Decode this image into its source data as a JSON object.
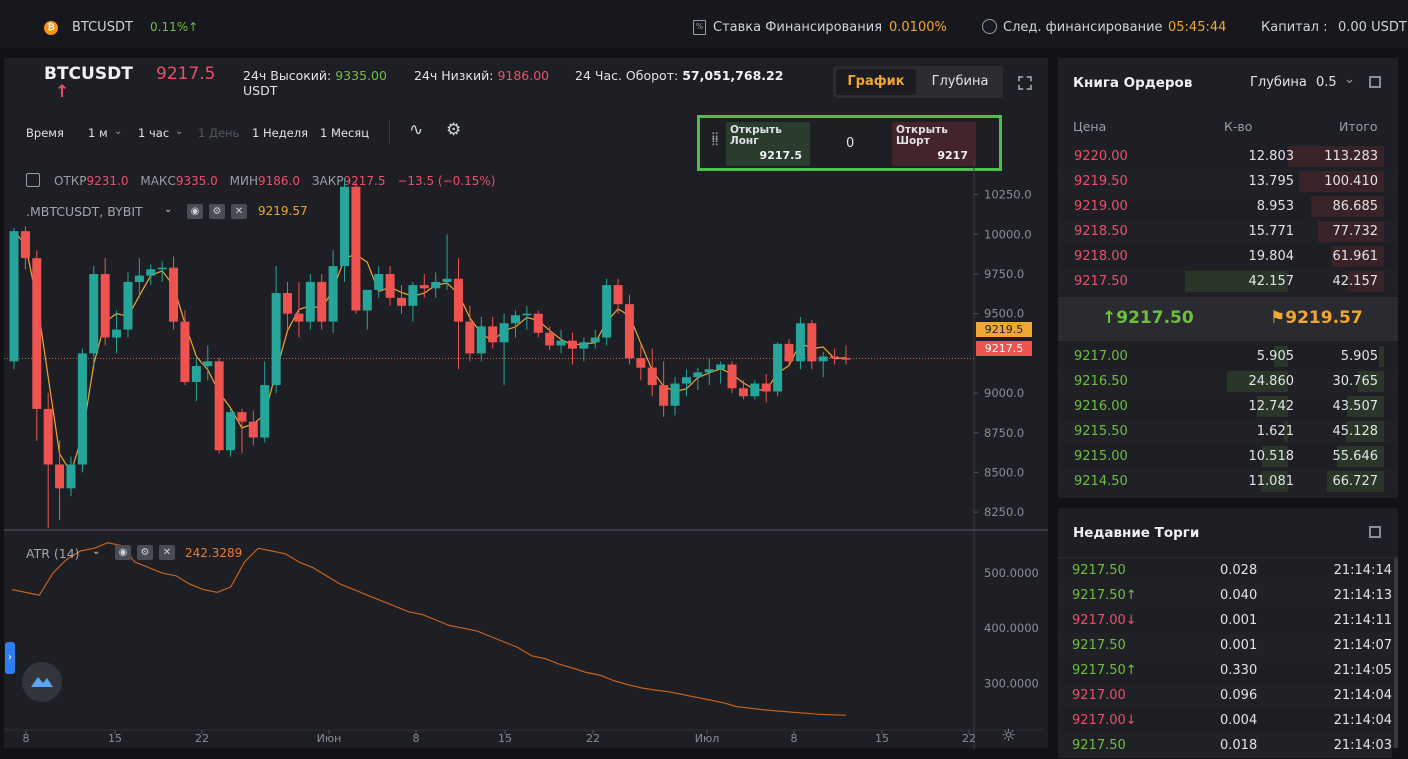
{
  "topbar": {
    "symbol": "BTCUSDT",
    "change": "0.11%↑",
    "funding_label": "Ставка Финансирования",
    "funding_value": "0.0100%",
    "next_funding_label": "След. финансирование",
    "next_funding_value": "05:45:44",
    "capital_label": "Капитал :",
    "capital_value": "0.00 USDT"
  },
  "header": {
    "symbol": "BTCUSDT",
    "price": "9217.5",
    "high_label": "24ч Высокий:",
    "high_value": "9335.00",
    "low_label": "24ч Низкий:",
    "low_value": "9186.00",
    "turnover_label": "24 Час. Оборот:",
    "turnover_value": "57,051,768.22",
    "turnover_unit": "USDT",
    "tab_chart": "График",
    "tab_depth": "Глубина"
  },
  "timeframes": {
    "time": "Время",
    "month": "1 м",
    "hour": "1 час",
    "day": "1 День",
    "week": "1 Неделя",
    "month1": "1 Месяц"
  },
  "trade_widget": {
    "long_label": "Открыть Лонг",
    "long_value": "9217.5",
    "qty": "0",
    "short_label": "Открыть Шорт",
    "short_value": "9217"
  },
  "ohlc": {
    "open_label": "ОТКР",
    "open": "9231.0",
    "high_label": "МАКС",
    "high": "9335.0",
    "low_label": "МИН",
    "low": "9186.0",
    "close_label": "ЗАКР",
    "close": "9217.5",
    "change": "−13.5 (−0.15%)"
  },
  "legend": {
    "series_name": ".MBTCUSDT, BYBIT",
    "series_value": "9219.57",
    "atr_name": "ATR (14)",
    "atr_value": "242.3289"
  },
  "price_axis": [
    "10250.0",
    "10000.0",
    "9750.0",
    "9500.0",
    "9000.0",
    "8750.0",
    "8500.0",
    "8250.0"
  ],
  "price_tag_index": "9219.5",
  "price_tag_last": "9217.5",
  "atr_axis": [
    "500.0000",
    "400.0000",
    "300.0000"
  ],
  "time_axis": [
    "8",
    "15",
    "22",
    "Июн",
    "8",
    "15",
    "22",
    "Июл",
    "8",
    "15",
    "22"
  ],
  "orderbook": {
    "title": "Книга Ордеров",
    "depth_label": "Глубина",
    "depth_value": "0.5",
    "col_price": "Цена",
    "col_qty": "К-во",
    "col_total": "Итого",
    "asks": [
      {
        "price": "9220.00",
        "qty": "12.803",
        "total": "113.283"
      },
      {
        "price": "9219.50",
        "qty": "13.795",
        "total": "100.410"
      },
      {
        "price": "9219.00",
        "qty": "8.953",
        "total": "86.685"
      },
      {
        "price": "9218.50",
        "qty": "15.771",
        "total": "77.732"
      },
      {
        "price": "9218.00",
        "qty": "19.804",
        "total": "61.961"
      },
      {
        "price": "9217.50",
        "qty": "42.157",
        "total": "42.157"
      }
    ],
    "last_price": "9217.50",
    "mark_price": "9219.57",
    "bids": [
      {
        "price": "9217.00",
        "qty": "5.905",
        "total": "5.905"
      },
      {
        "price": "9216.50",
        "qty": "24.860",
        "total": "30.765"
      },
      {
        "price": "9216.00",
        "qty": "12.742",
        "total": "43.507"
      },
      {
        "price": "9215.50",
        "qty": "1.621",
        "total": "45.128"
      },
      {
        "price": "9215.00",
        "qty": "10.518",
        "total": "55.646"
      },
      {
        "price": "9214.50",
        "qty": "11.081",
        "total": "66.727"
      }
    ]
  },
  "recent_trades": {
    "title": "Недавние Торги",
    "rows": [
      {
        "price": "9217.50",
        "qty": "0.028",
        "time": "21:14:14",
        "side": "buy"
      },
      {
        "price": "9217.50↑",
        "qty": "0.040",
        "time": "21:14:13",
        "side": "buy"
      },
      {
        "price": "9217.00↓",
        "qty": "0.001",
        "time": "21:14:11",
        "side": "sell"
      },
      {
        "price": "9217.50",
        "qty": "0.001",
        "time": "21:14:07",
        "side": "buy"
      },
      {
        "price": "9217.50↑",
        "qty": "0.330",
        "time": "21:14:05",
        "side": "buy"
      },
      {
        "price": "9217.00",
        "qty": "0.096",
        "time": "21:14:04",
        "side": "sell"
      },
      {
        "price": "9217.00↓",
        "qty": "0.004",
        "time": "21:14:04",
        "side": "sell"
      },
      {
        "price": "9217.50",
        "qty": "0.018",
        "time": "21:14:03",
        "side": "buy"
      }
    ]
  },
  "colors": {
    "up": "#26a69a",
    "down": "#ef5350",
    "ma": "#f0a635",
    "atr": "#c4621f"
  },
  "chart_data": {
    "type": "candlestick",
    "series": [
      {
        "name": ".MBTCUSDT, BYBIT",
        "ohlc": [
          [
            9200,
            10040,
            9150,
            10020
          ],
          [
            10020,
            10050,
            9780,
            9850
          ],
          [
            9850,
            9900,
            8700,
            8900
          ],
          [
            8900,
            9000,
            8150,
            8550
          ],
          [
            8550,
            8700,
            8200,
            8400
          ],
          [
            8400,
            8600,
            8350,
            8550
          ],
          [
            8550,
            9280,
            8500,
            9250
          ],
          [
            9250,
            9800,
            9150,
            9750
          ],
          [
            9750,
            9850,
            9300,
            9350
          ],
          [
            9350,
            9520,
            9250,
            9400
          ],
          [
            9400,
            9760,
            9350,
            9700
          ],
          [
            9700,
            9850,
            9600,
            9740
          ],
          [
            9740,
            9810,
            9680,
            9780
          ],
          [
            9780,
            9830,
            9700,
            9790
          ],
          [
            9790,
            9860,
            9400,
            9450
          ],
          [
            9450,
            9520,
            9050,
            9070
          ],
          [
            9070,
            9220,
            8950,
            9170
          ],
          [
            9170,
            9300,
            9080,
            9200
          ],
          [
            9200,
            9220,
            8620,
            8640
          ],
          [
            8640,
            8900,
            8600,
            8880
          ],
          [
            8880,
            8900,
            8620,
            8820
          ],
          [
            8820,
            8890,
            8670,
            8720
          ],
          [
            8720,
            9200,
            8690,
            9050
          ],
          [
            9050,
            9800,
            9000,
            9630
          ],
          [
            9630,
            9700,
            9400,
            9500
          ],
          [
            9500,
            9700,
            9350,
            9450
          ],
          [
            9450,
            9750,
            9400,
            9700
          ],
          [
            9700,
            9750,
            9400,
            9450
          ],
          [
            9450,
            9900,
            9380,
            9800
          ],
          [
            9800,
            10350,
            9700,
            10300
          ],
          [
            10300,
            10330,
            9500,
            9520
          ],
          [
            9520,
            9600,
            9400,
            9650
          ],
          [
            9650,
            9800,
            9600,
            9750
          ],
          [
            9750,
            9800,
            9550,
            9600
          ],
          [
            9600,
            9680,
            9500,
            9550
          ],
          [
            9550,
            9700,
            9450,
            9680
          ],
          [
            9680,
            9750,
            9600,
            9660
          ],
          [
            9660,
            9760,
            9600,
            9700
          ],
          [
            9700,
            10000,
            9650,
            9720
          ],
          [
            9720,
            9850,
            9150,
            9450
          ],
          [
            9450,
            9550,
            9200,
            9250
          ],
          [
            9250,
            9480,
            9200,
            9420
          ],
          [
            9420,
            9480,
            9280,
            9320
          ],
          [
            9320,
            9500,
            9050,
            9440
          ],
          [
            9440,
            9520,
            9350,
            9490
          ],
          [
            9490,
            9550,
            9400,
            9500
          ],
          [
            9500,
            9520,
            9350,
            9380
          ],
          [
            9380,
            9420,
            9270,
            9300
          ],
          [
            9300,
            9400,
            9250,
            9330
          ],
          [
            9330,
            9380,
            9180,
            9280
          ],
          [
            9280,
            9350,
            9200,
            9320
          ],
          [
            9320,
            9400,
            9280,
            9350
          ],
          [
            9350,
            9720,
            9300,
            9680
          ],
          [
            9680,
            9720,
            9500,
            9560
          ],
          [
            9560,
            9620,
            9180,
            9220
          ],
          [
            9220,
            9300,
            9080,
            9160
          ],
          [
            9160,
            9280,
            8980,
            9050
          ],
          [
            9050,
            9200,
            8850,
            8920
          ],
          [
            8920,
            9100,
            8860,
            9060
          ],
          [
            9060,
            9150,
            8980,
            9100
          ],
          [
            9100,
            9160,
            9020,
            9130
          ],
          [
            9130,
            9220,
            9050,
            9150
          ],
          [
            9150,
            9200,
            9060,
            9180
          ],
          [
            9180,
            9200,
            9000,
            9030
          ],
          [
            9030,
            9080,
            8960,
            8980
          ],
          [
            8980,
            9080,
            8960,
            9060
          ],
          [
            9060,
            9120,
            8940,
            9010
          ],
          [
            9010,
            9320,
            8980,
            9310
          ],
          [
            9310,
            9340,
            9180,
            9200
          ],
          [
            9200,
            9480,
            9150,
            9440
          ],
          [
            9440,
            9460,
            9150,
            9200
          ],
          [
            9200,
            9260,
            9100,
            9230
          ],
          [
            9230,
            9280,
            9180,
            9220
          ],
          [
            9220,
            9300,
            9180,
            9217.5
          ]
        ]
      },
      {
        "name": "ATR (14)",
        "values": [
          470,
          465,
          460,
          500,
          525,
          540,
          545,
          555,
          550,
          520,
          510,
          500,
          495,
          480,
          470,
          465,
          475,
          520,
          545,
          540,
          535,
          520,
          510,
          495,
          480,
          470,
          460,
          450,
          440,
          430,
          425,
          415,
          405,
          400,
          395,
          385,
          375,
          365,
          350,
          345,
          335,
          328,
          320,
          315,
          305,
          298,
          292,
          288,
          285,
          280,
          275,
          270,
          265,
          258,
          255,
          252,
          250,
          248,
          246,
          244,
          243,
          242.3289
        ]
      }
    ],
    "price_axis_range": [
      8150,
      10380
    ],
    "atr_axis_range": [
      230,
      560
    ]
  }
}
